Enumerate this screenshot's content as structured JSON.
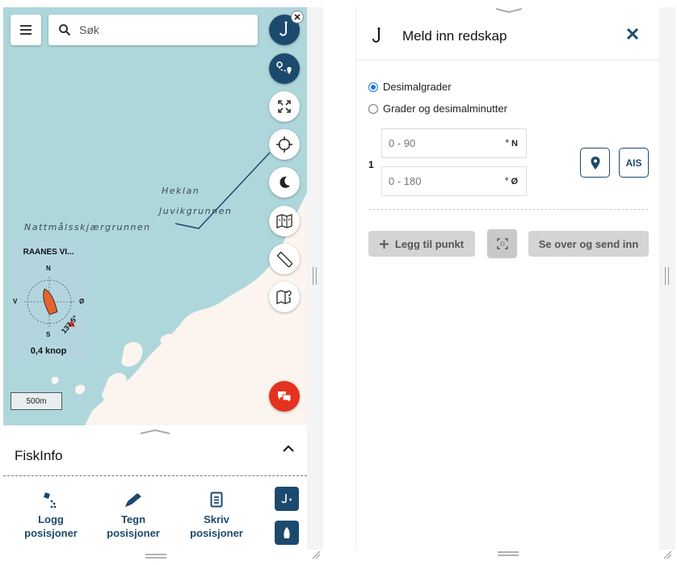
{
  "left": {
    "search": {
      "placeholder": "Søk"
    },
    "map_labels": {
      "heklan": "Heklan",
      "juvikgrunnen": "Juvikgrunnen",
      "nattmalsskjaergrunnen": "Nattmålsskjærgrunnen"
    },
    "compass": {
      "vessel_name": "RAANES VI...",
      "north": "N",
      "south": "S",
      "west": "V",
      "east": "Ø",
      "heading": "137,5°",
      "speed": "0,4 knop"
    },
    "scale": "500m",
    "panel": {
      "title": "FiskInfo",
      "actions": [
        {
          "line1": "Logg",
          "line2": "posisjoner",
          "icon": "log-positions-icon"
        },
        {
          "line1": "Tegn",
          "line2": "posisjoner",
          "icon": "pencil-icon"
        },
        {
          "line1": "Skriv",
          "line2": "posisjoner",
          "icon": "document-icon"
        }
      ]
    },
    "icons": [
      "menu-icon",
      "search-icon",
      "hook-icon",
      "route-icon",
      "fullscreen-icon",
      "crosshair-icon",
      "moon-icon",
      "map-layers-icon",
      "ruler-icon",
      "map-question-icon",
      "chat-icon"
    ],
    "colors": {
      "sea": "#aed7dc",
      "land": "#fbf4ef",
      "accent": "#1c4a6e",
      "alert": "#e4321f"
    }
  },
  "right": {
    "title": "Meld inn redskap",
    "radio": {
      "option1": "Desimalgrader",
      "option2": "Grader og desimalminutter",
      "selected": "Desimalgrader"
    },
    "row_number": "1",
    "lat": {
      "placeholder": "0 - 90",
      "unit": "° N"
    },
    "lon": {
      "placeholder": "0 - 180",
      "unit": "° Ø"
    },
    "ais_label": "AIS",
    "add_point": "Legg til punkt",
    "review_send": "Se over og send inn"
  }
}
